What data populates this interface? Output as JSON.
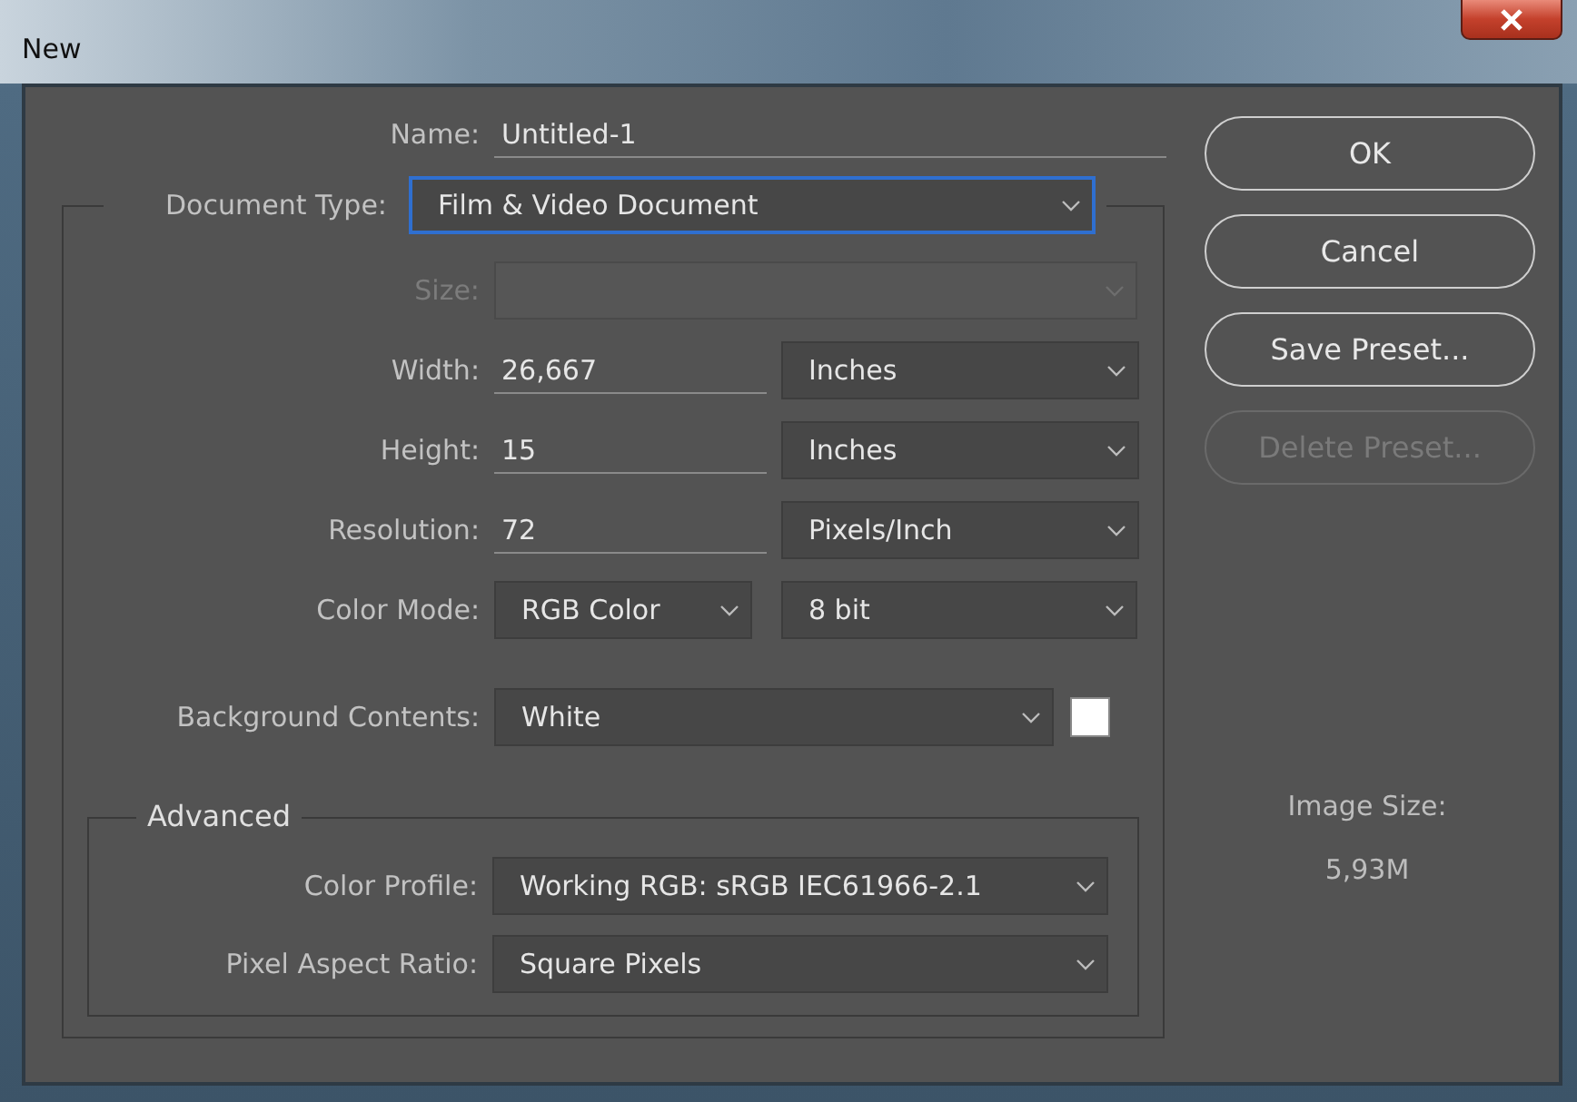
{
  "window": {
    "title": "New"
  },
  "name": {
    "label": "Name:",
    "value": "Untitled-1"
  },
  "document_type": {
    "label": "Document Type:",
    "value": "Film & Video Document",
    "focused": true
  },
  "rows": [
    {
      "kind": "select",
      "label": "Size:",
      "disabled": true
    },
    {
      "kind": "input_unit",
      "label": "Width:",
      "value": "26,667",
      "unit": "Inches",
      "disabled": false
    },
    {
      "kind": "input_unit",
      "label": "Height:",
      "value": "15",
      "unit": "Inches",
      "disabled": false
    },
    {
      "kind": "input_unit",
      "label": "Resolution:",
      "value": "72",
      "unit": "Pixels/Inch",
      "disabled": false
    },
    {
      "kind": "select_pair",
      "label": "Color Mode:",
      "value": "RGB Color",
      "second": "8 bit",
      "disabled": false
    },
    {
      "kind": "select_swatch",
      "label": "Background Contents:",
      "value": "White",
      "color": "#ffffff",
      "disabled": false
    }
  ],
  "advanced": {
    "title": "Advanced",
    "rows": [
      {
        "label": "Color Profile:",
        "value": "Working RGB:  sRGB IEC61966-2.1"
      },
      {
        "label": "Pixel Aspect Ratio:",
        "value": "Square Pixels"
      }
    ]
  },
  "buttons": [
    {
      "label": "OK",
      "disabled": false
    },
    {
      "label": "Cancel",
      "disabled": false
    },
    {
      "label": "Save Preset...",
      "disabled": false
    },
    {
      "label": "Delete Preset...",
      "disabled": true
    }
  ],
  "image_size": {
    "label": "Image Size:",
    "value": "5,93M"
  }
}
